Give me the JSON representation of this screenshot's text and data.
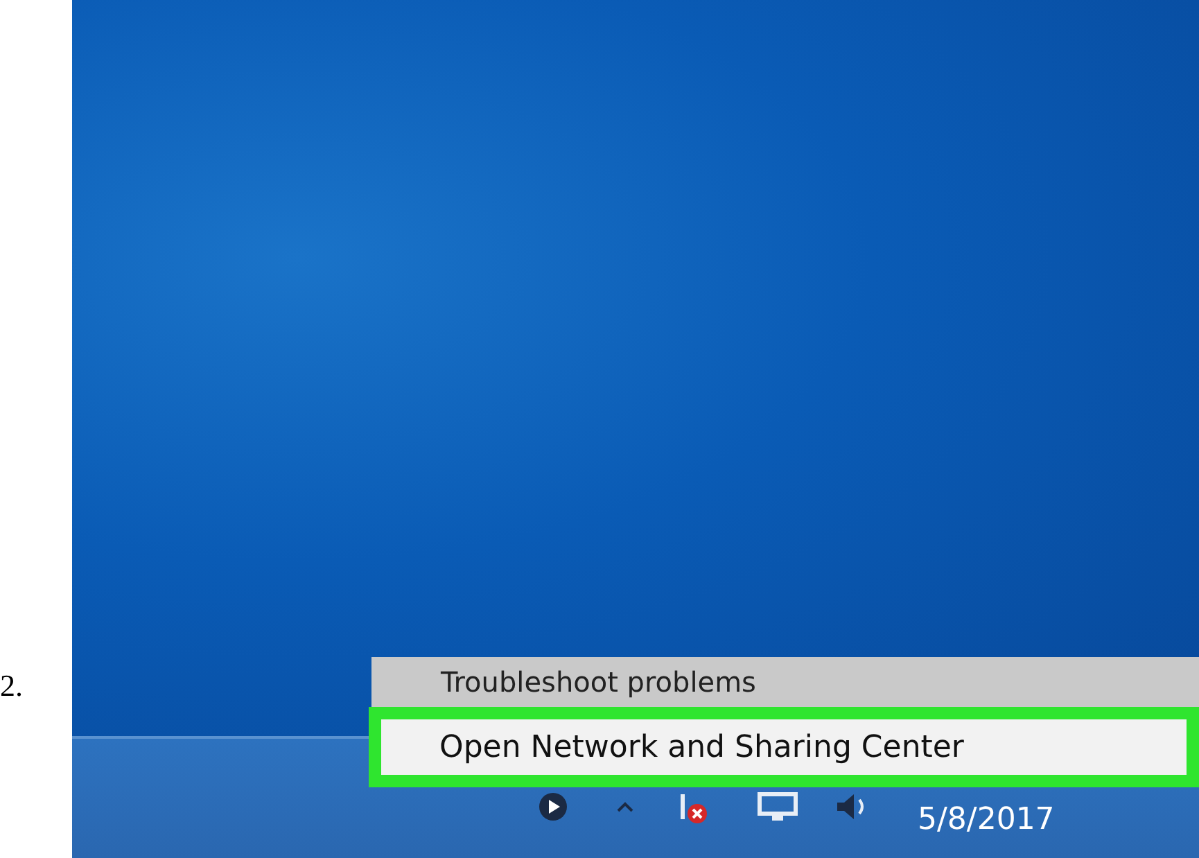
{
  "step_number": "2.",
  "context_menu": {
    "items": [
      {
        "label": "Troubleshoot problems",
        "selected": false
      },
      {
        "label": "Open Network and Sharing Center",
        "selected": true
      }
    ]
  },
  "taskbar": {
    "clock": "5/8/2017"
  }
}
